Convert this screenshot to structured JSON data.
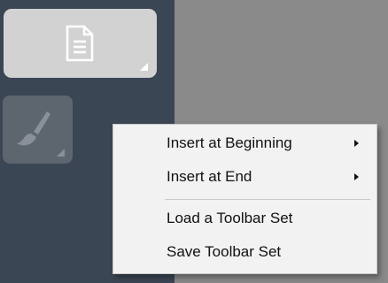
{
  "toolbar": {
    "buttons": [
      {
        "icon": "document-icon",
        "state": "active"
      },
      {
        "icon": "brush-icon",
        "state": "disabled"
      }
    ]
  },
  "context_menu": {
    "items": [
      {
        "label": "Insert at Beginning",
        "has_submenu": true
      },
      {
        "label": "Insert at End",
        "has_submenu": true
      },
      {
        "label": "Load a Toolbar Set",
        "has_submenu": false
      },
      {
        "label": "Save Toolbar Set",
        "has_submenu": false
      }
    ]
  },
  "colors": {
    "sidebar": "#3b4654",
    "canvas": "#8a8a8a",
    "menu_background": "#f2f2f2",
    "button_active": "#d2d2d2",
    "button_disabled": "#5d656f"
  }
}
